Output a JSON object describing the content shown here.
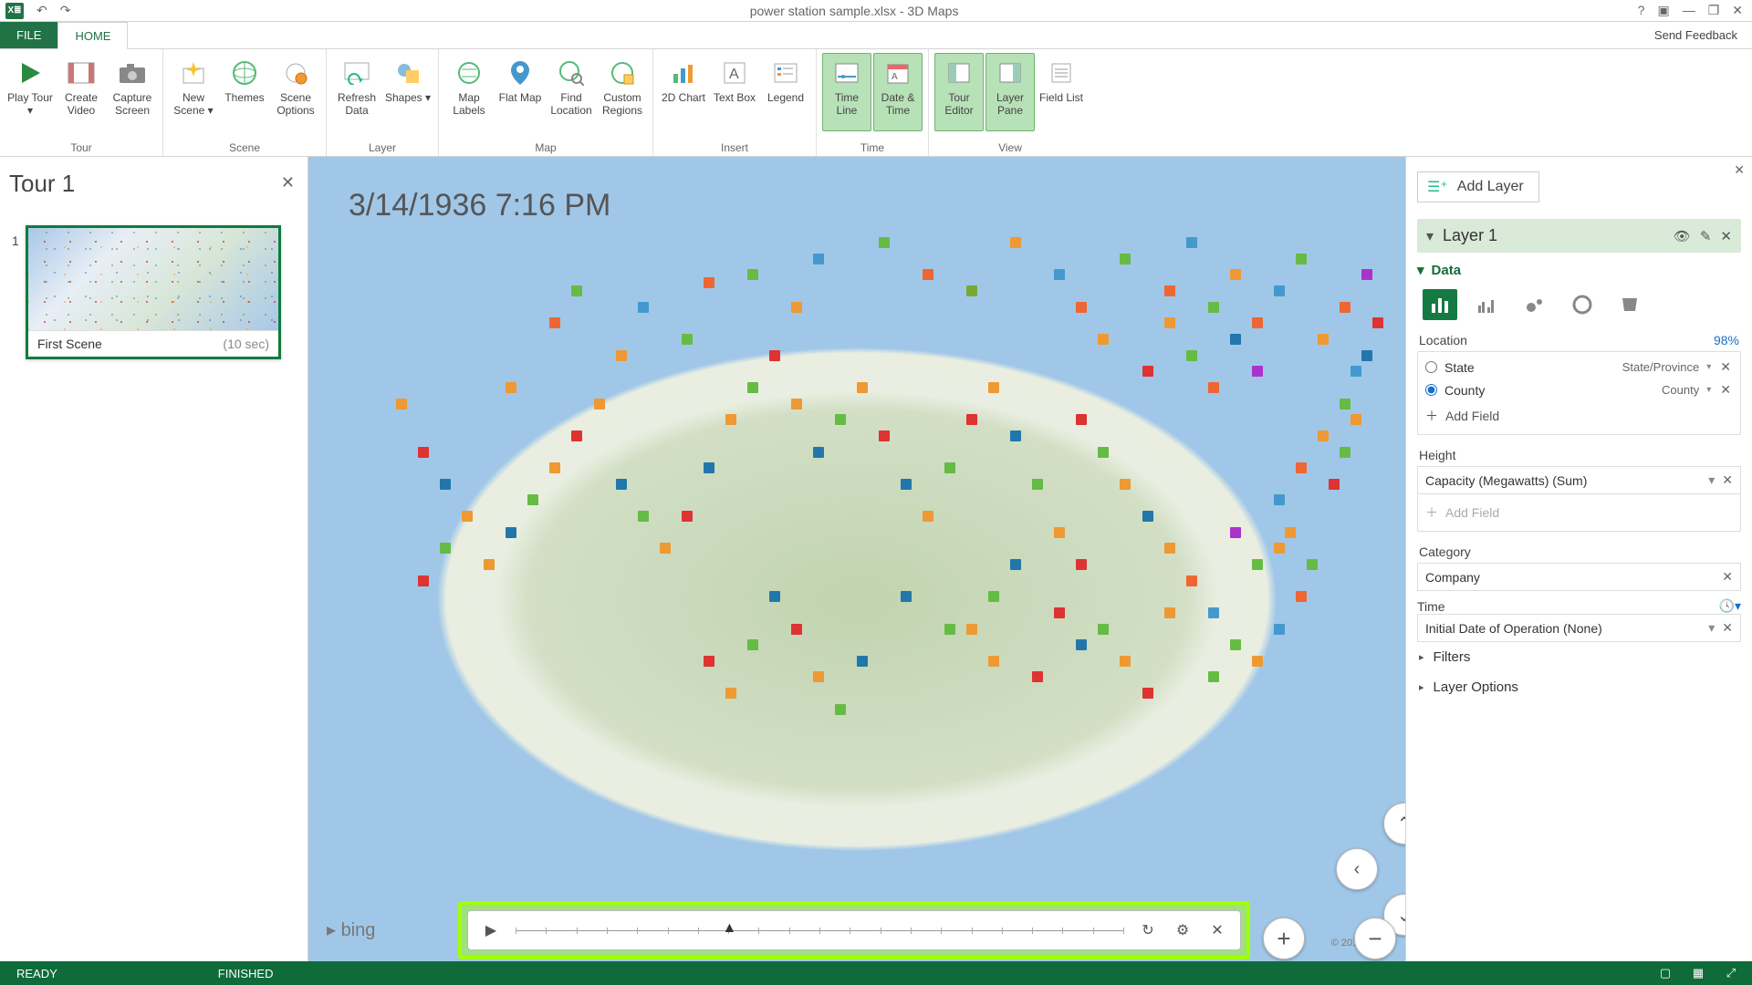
{
  "window": {
    "title": "power station sample.xlsx - 3D Maps"
  },
  "tabs": {
    "file": "FILE",
    "home": "HOME"
  },
  "feedback": "Send Feedback",
  "ribbon": {
    "groups": {
      "tour": {
        "label": "Tour",
        "play": "Play\nTour ▾",
        "createVideo": "Create\nVideo",
        "capture": "Capture\nScreen"
      },
      "scene": {
        "label": "Scene",
        "newScene": "New\nScene ▾",
        "themes": "Themes",
        "sceneOptions": "Scene\nOptions"
      },
      "layer": {
        "label": "Layer",
        "refresh": "Refresh\nData",
        "shapes": "Shapes ▾"
      },
      "map": {
        "label": "Map",
        "mapLabels": "Map\nLabels",
        "flatMap": "Flat\nMap",
        "findLocation": "Find\nLocation",
        "customRegions": "Custom\nRegions"
      },
      "insert": {
        "label": "Insert",
        "chart2d": "2D\nChart",
        "textBox": "Text\nBox",
        "legend": "Legend"
      },
      "time": {
        "label": "Time",
        "timeLine": "Time\nLine",
        "dateTime": "Date &\nTime"
      },
      "view": {
        "label": "View",
        "tourEditor": "Tour\nEditor",
        "layerPane": "Layer\nPane",
        "fieldList": "Field\nList"
      }
    }
  },
  "tourPane": {
    "title": "Tour 1",
    "sceneNum": "1",
    "sceneName": "First Scene",
    "sceneDuration": "(10 sec)"
  },
  "map": {
    "datestamp": "3/14/1936 7:16 PM",
    "bing": "bing",
    "credits": "© 2016 HERE",
    "timelineProgress": 0.34,
    "markers": [
      {
        "x": 34,
        "y": 22,
        "c": "#6b4"
      },
      {
        "x": 36,
        "y": 15,
        "c": "#e63"
      },
      {
        "x": 30,
        "y": 18,
        "c": "#49c"
      },
      {
        "x": 28,
        "y": 24,
        "c": "#e93"
      },
      {
        "x": 22,
        "y": 20,
        "c": "#e63"
      },
      {
        "x": 24,
        "y": 16,
        "c": "#6b4"
      },
      {
        "x": 18,
        "y": 28,
        "c": "#e93"
      },
      {
        "x": 40,
        "y": 14,
        "c": "#6b4"
      },
      {
        "x": 44,
        "y": 18,
        "c": "#e93"
      },
      {
        "x": 46,
        "y": 12,
        "c": "#49c"
      },
      {
        "x": 52,
        "y": 10,
        "c": "#6b4"
      },
      {
        "x": 56,
        "y": 14,
        "c": "#e63"
      },
      {
        "x": 60,
        "y": 16,
        "c": "#7a3"
      },
      {
        "x": 64,
        "y": 10,
        "c": "#e93"
      },
      {
        "x": 68,
        "y": 14,
        "c": "#49c"
      },
      {
        "x": 70,
        "y": 18,
        "c": "#e63"
      },
      {
        "x": 72,
        "y": 22,
        "c": "#e93"
      },
      {
        "x": 74,
        "y": 12,
        "c": "#6b4"
      },
      {
        "x": 78,
        "y": 16,
        "c": "#e63"
      },
      {
        "x": 80,
        "y": 10,
        "c": "#49c"
      },
      {
        "x": 82,
        "y": 18,
        "c": "#6b4"
      },
      {
        "x": 84,
        "y": 14,
        "c": "#e93"
      },
      {
        "x": 86,
        "y": 20,
        "c": "#e63"
      },
      {
        "x": 88,
        "y": 16,
        "c": "#49c"
      },
      {
        "x": 90,
        "y": 12,
        "c": "#6b4"
      },
      {
        "x": 92,
        "y": 22,
        "c": "#e93"
      },
      {
        "x": 94,
        "y": 18,
        "c": "#e63"
      },
      {
        "x": 95,
        "y": 26,
        "c": "#49c"
      },
      {
        "x": 94,
        "y": 30,
        "c": "#6b4"
      },
      {
        "x": 92,
        "y": 34,
        "c": "#e93"
      },
      {
        "x": 90,
        "y": 38,
        "c": "#e63"
      },
      {
        "x": 88,
        "y": 42,
        "c": "#49c"
      },
      {
        "x": 89,
        "y": 46,
        "c": "#e93"
      },
      {
        "x": 91,
        "y": 50,
        "c": "#6b4"
      },
      {
        "x": 90,
        "y": 54,
        "c": "#e63"
      },
      {
        "x": 88,
        "y": 58,
        "c": "#49c"
      },
      {
        "x": 86,
        "y": 62,
        "c": "#e93"
      },
      {
        "x": 84,
        "y": 60,
        "c": "#6b4"
      },
      {
        "x": 82,
        "y": 56,
        "c": "#49c"
      },
      {
        "x": 80,
        "y": 52,
        "c": "#e63"
      },
      {
        "x": 78,
        "y": 48,
        "c": "#e93"
      },
      {
        "x": 96,
        "y": 14,
        "c": "#a3c"
      },
      {
        "x": 97,
        "y": 20,
        "c": "#d33"
      },
      {
        "x": 96,
        "y": 24,
        "c": "#27a"
      },
      {
        "x": 95,
        "y": 32,
        "c": "#e93"
      },
      {
        "x": 94,
        "y": 36,
        "c": "#6b4"
      },
      {
        "x": 93,
        "y": 40,
        "c": "#d33"
      },
      {
        "x": 76,
        "y": 44,
        "c": "#27a"
      },
      {
        "x": 74,
        "y": 40,
        "c": "#e93"
      },
      {
        "x": 72,
        "y": 36,
        "c": "#6b4"
      },
      {
        "x": 70,
        "y": 32,
        "c": "#d33"
      },
      {
        "x": 8,
        "y": 30,
        "c": "#e93"
      },
      {
        "x": 10,
        "y": 36,
        "c": "#d33"
      },
      {
        "x": 12,
        "y": 40,
        "c": "#27a"
      },
      {
        "x": 14,
        "y": 44,
        "c": "#e93"
      },
      {
        "x": 12,
        "y": 48,
        "c": "#6b4"
      },
      {
        "x": 10,
        "y": 52,
        "c": "#d33"
      },
      {
        "x": 16,
        "y": 50,
        "c": "#e93"
      },
      {
        "x": 18,
        "y": 46,
        "c": "#27a"
      },
      {
        "x": 20,
        "y": 42,
        "c": "#6b4"
      },
      {
        "x": 22,
        "y": 38,
        "c": "#e93"
      },
      {
        "x": 24,
        "y": 34,
        "c": "#d33"
      },
      {
        "x": 26,
        "y": 30,
        "c": "#e93"
      },
      {
        "x": 28,
        "y": 40,
        "c": "#27a"
      },
      {
        "x": 30,
        "y": 44,
        "c": "#6b4"
      },
      {
        "x": 32,
        "y": 48,
        "c": "#e93"
      },
      {
        "x": 34,
        "y": 44,
        "c": "#d33"
      },
      {
        "x": 36,
        "y": 38,
        "c": "#27a"
      },
      {
        "x": 38,
        "y": 32,
        "c": "#e93"
      },
      {
        "x": 40,
        "y": 28,
        "c": "#6b4"
      },
      {
        "x": 42,
        "y": 24,
        "c": "#d33"
      },
      {
        "x": 44,
        "y": 30,
        "c": "#e93"
      },
      {
        "x": 46,
        "y": 36,
        "c": "#27a"
      },
      {
        "x": 48,
        "y": 32,
        "c": "#6b4"
      },
      {
        "x": 50,
        "y": 28,
        "c": "#e93"
      },
      {
        "x": 52,
        "y": 34,
        "c": "#d33"
      },
      {
        "x": 54,
        "y": 40,
        "c": "#27a"
      },
      {
        "x": 56,
        "y": 44,
        "c": "#e93"
      },
      {
        "x": 58,
        "y": 38,
        "c": "#6b4"
      },
      {
        "x": 60,
        "y": 32,
        "c": "#d33"
      },
      {
        "x": 62,
        "y": 28,
        "c": "#e93"
      },
      {
        "x": 64,
        "y": 34,
        "c": "#27a"
      },
      {
        "x": 66,
        "y": 40,
        "c": "#6b4"
      },
      {
        "x": 68,
        "y": 46,
        "c": "#e93"
      },
      {
        "x": 70,
        "y": 50,
        "c": "#d33"
      },
      {
        "x": 54,
        "y": 54,
        "c": "#27a"
      },
      {
        "x": 58,
        "y": 58,
        "c": "#6b4"
      },
      {
        "x": 62,
        "y": 62,
        "c": "#e93"
      },
      {
        "x": 66,
        "y": 64,
        "c": "#d33"
      },
      {
        "x": 50,
        "y": 62,
        "c": "#27a"
      },
      {
        "x": 48,
        "y": 68,
        "c": "#6b4"
      },
      {
        "x": 46,
        "y": 64,
        "c": "#e93"
      },
      {
        "x": 44,
        "y": 58,
        "c": "#d33"
      },
      {
        "x": 42,
        "y": 54,
        "c": "#27a"
      },
      {
        "x": 40,
        "y": 60,
        "c": "#6b4"
      },
      {
        "x": 38,
        "y": 66,
        "c": "#e93"
      },
      {
        "x": 36,
        "y": 62,
        "c": "#d33"
      },
      {
        "x": 86,
        "y": 26,
        "c": "#a3c"
      },
      {
        "x": 84,
        "y": 22,
        "c": "#27a"
      },
      {
        "x": 82,
        "y": 28,
        "c": "#e63"
      },
      {
        "x": 80,
        "y": 24,
        "c": "#6b4"
      },
      {
        "x": 78,
        "y": 20,
        "c": "#e93"
      },
      {
        "x": 76,
        "y": 26,
        "c": "#d33"
      },
      {
        "x": 84,
        "y": 46,
        "c": "#a3c"
      },
      {
        "x": 86,
        "y": 50,
        "c": "#6b4"
      },
      {
        "x": 88,
        "y": 48,
        "c": "#e93"
      },
      {
        "x": 64,
        "y": 50,
        "c": "#27a"
      },
      {
        "x": 62,
        "y": 54,
        "c": "#6b4"
      },
      {
        "x": 60,
        "y": 58,
        "c": "#e93"
      },
      {
        "x": 68,
        "y": 56,
        "c": "#d33"
      },
      {
        "x": 70,
        "y": 60,
        "c": "#27a"
      },
      {
        "x": 72,
        "y": 58,
        "c": "#6b4"
      },
      {
        "x": 74,
        "y": 62,
        "c": "#e93"
      },
      {
        "x": 76,
        "y": 66,
        "c": "#d33"
      },
      {
        "x": 78,
        "y": 56,
        "c": "#e93"
      },
      {
        "x": 82,
        "y": 64,
        "c": "#6b4"
      }
    ]
  },
  "layerPane": {
    "addLayer": "Add Layer",
    "layerName": "Layer 1",
    "data": "Data",
    "location": {
      "label": "Location",
      "percent": "98%",
      "rows": [
        {
          "name": "State",
          "mapping": "State/Province",
          "selected": false
        },
        {
          "name": "County",
          "mapping": "County",
          "selected": true
        }
      ],
      "add": "Add Field"
    },
    "height": {
      "label": "Height",
      "field": "Capacity (Megawatts) (Sum)",
      "add": "Add Field"
    },
    "category": {
      "label": "Category",
      "field": "Company"
    },
    "time": {
      "label": "Time",
      "field": "Initial Date of Operation (None)"
    },
    "filters": "Filters",
    "layerOptions": "Layer Options"
  },
  "status": {
    "ready": "READY",
    "finished": "FINISHED"
  }
}
